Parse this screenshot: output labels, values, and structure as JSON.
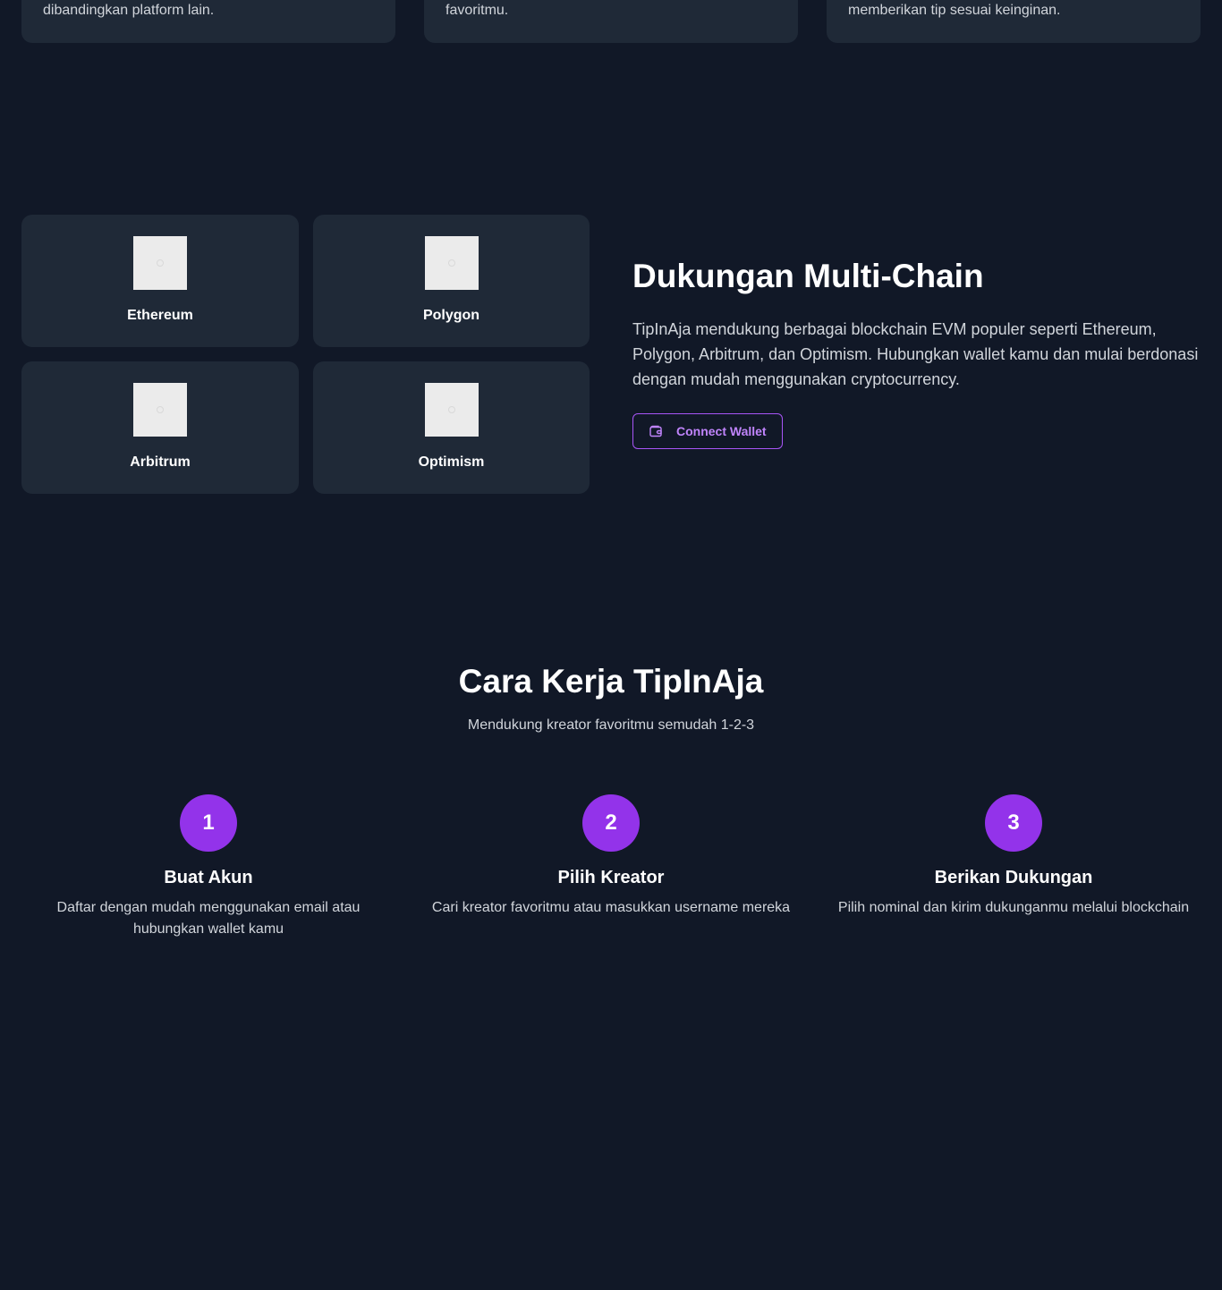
{
  "features": {
    "cards": [
      {
        "text": "dibandingkan platform lain."
      },
      {
        "text": "favoritmu."
      },
      {
        "text": "memberikan tip sesuai keinginan."
      }
    ]
  },
  "multichain": {
    "chains": [
      {
        "name": "Ethereum",
        "icon": "ethereum-logo-placeholder"
      },
      {
        "name": "Polygon",
        "icon": "polygon-logo-placeholder"
      },
      {
        "name": "Arbitrum",
        "icon": "arbitrum-logo-placeholder"
      },
      {
        "name": "Optimism",
        "icon": "optimism-logo-placeholder"
      }
    ],
    "title": "Dukungan Multi-Chain",
    "description": "TipInAja mendukung berbagai blockchain EVM populer seperti Ethereum, Polygon, Arbitrum, dan Optimism. Hubungkan wallet kamu dan mulai berdonasi dengan mudah menggunakan cryptocurrency.",
    "connect_label": "Connect Wallet",
    "connect_icon": "wallet-icon"
  },
  "how_it_works": {
    "title": "Cara Kerja TipInAja",
    "subtitle": "Mendukung kreator favoritmu semudah 1-2-3",
    "steps": [
      {
        "number": "1",
        "title": "Buat Akun",
        "description": "Daftar dengan mudah menggunakan email atau hubungkan wallet kamu"
      },
      {
        "number": "2",
        "title": "Pilih Kreator",
        "description": "Cari kreator favoritmu atau masukkan username mereka"
      },
      {
        "number": "3",
        "title": "Berikan Dukungan",
        "description": "Pilih nominal dan kirim dukunganmu melalui blockchain"
      }
    ]
  },
  "colors": {
    "background": "#111827",
    "card": "#1f2937",
    "accent": "#9333ea",
    "accent_border": "#a855f7",
    "muted_text": "#d1d5db"
  }
}
